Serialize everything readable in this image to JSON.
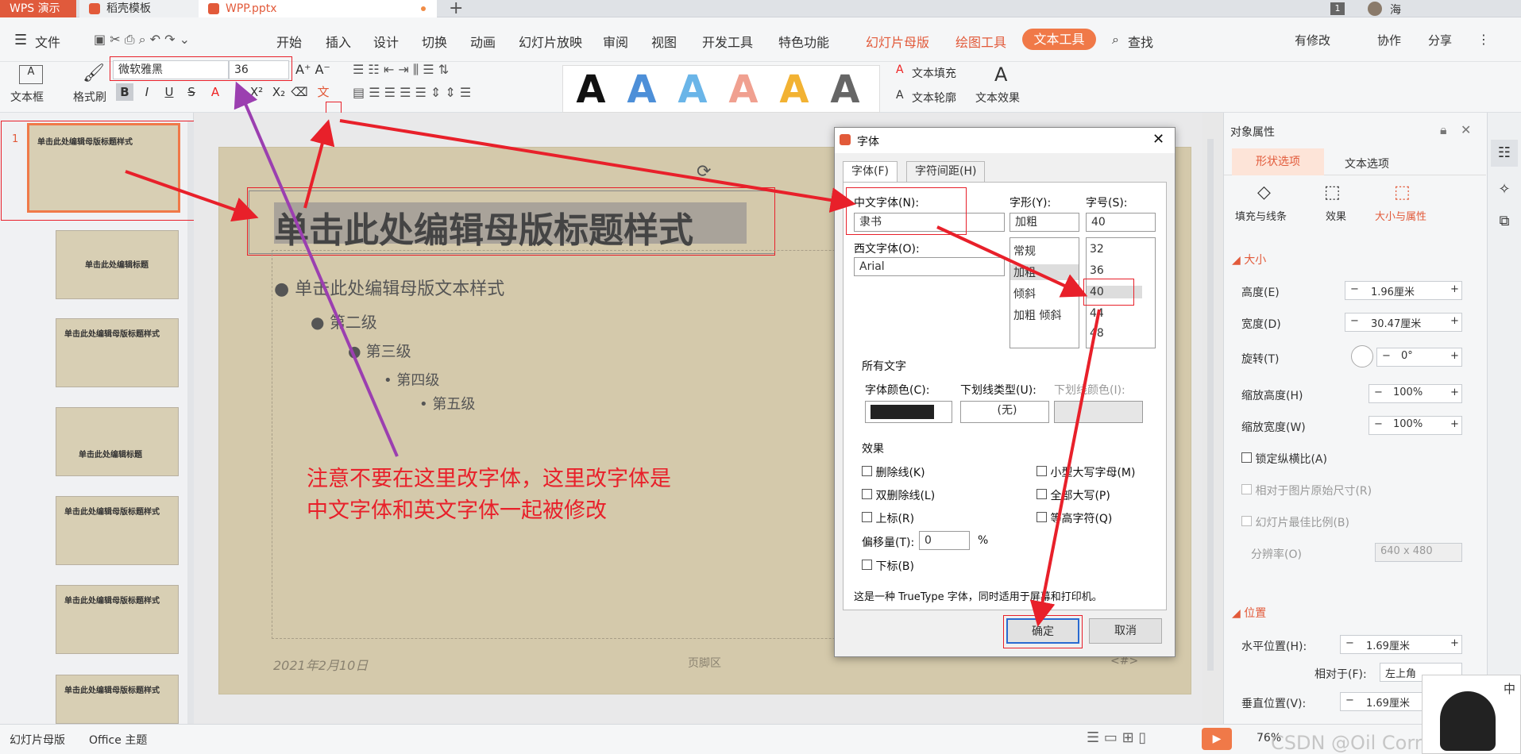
{
  "tabbar": {
    "brand": "WPS 演示",
    "tab1": "稻壳模板",
    "tab2": "WPP.pptx",
    "user_badge": "1",
    "user": "海"
  },
  "menu": {
    "file": "文件",
    "items": [
      "开始",
      "插入",
      "设计",
      "切换",
      "动画",
      "幻灯片放映",
      "审阅",
      "视图",
      "开发工具",
      "特色功能"
    ],
    "hl1": "幻灯片母版",
    "hl2": "绘图工具",
    "active": "文本工具",
    "search": "查找",
    "right": [
      "有修改",
      "协作",
      "分享"
    ]
  },
  "ribbon": {
    "textbox": "文本框",
    "format_brush": "格式刷",
    "font": "微软雅黑",
    "size": "36",
    "fill": "文本填充",
    "outline": "文本轮廓",
    "effect": "文本效果",
    "wordart": [
      "A",
      "A",
      "A",
      "A",
      "A",
      "A"
    ],
    "wordart_colors": [
      "#111111",
      "#4d8fd8",
      "#6ab5e8",
      "#f0a090",
      "#f2b233",
      "#666666"
    ]
  },
  "slide": {
    "title": "单击此处编辑母版标题样式",
    "l1": "单击此处编辑母版文本样式",
    "l2": "第二级",
    "l3": "第三级",
    "l4": "第四级",
    "l5": "第五级",
    "date": "2021年2月10日",
    "footer": "页脚区",
    "page": "<#>",
    "note1": "注意不要在这里改字体，这里改字体是",
    "note2": "中文字体和英文字体一起被修改"
  },
  "thumbs": {
    "first_num": "1",
    "t1": "单击此处编辑母版标题样式",
    "t2": "单击此处编辑标题",
    "t3": "单击此处编辑母版标题样式",
    "t4": "单击此处编辑标题",
    "t5": "单击此处编辑母版标题样式",
    "t6": "单击此处编辑母版标题样式",
    "t7": "单击此处编辑母版标题样式"
  },
  "dialog": {
    "title": "字体",
    "tab_font": "字体(F)",
    "tab_spacing": "字符间距(H)",
    "cn_font_label": "中文字体(N):",
    "cn_font": "隶书",
    "west_font_label": "西文字体(O):",
    "west_font": "Arial",
    "style_label": "字形(Y):",
    "style_val": "加粗",
    "styles": [
      "常规",
      "加粗",
      "倾斜",
      "加粗 倾斜"
    ],
    "size_label": "字号(S):",
    "size_val": "40",
    "sizes": [
      "32",
      "36",
      "40",
      "44",
      "48"
    ],
    "all_text": "所有文字",
    "color_label": "字体颜色(C):",
    "underline_label": "下划线类型(U):",
    "underline_val": "(无)",
    "ucolor_label": "下划线颜色(I):",
    "effects": "效果",
    "cb_left": [
      "删除线(K)",
      "双删除线(L)",
      "上标(R)"
    ],
    "cb_right": [
      "小型大写字母(M)",
      "全部大写(P)",
      "等高字符(Q)"
    ],
    "offset_label": "偏移量(T):",
    "offset_val": "0",
    "pct": "%",
    "subscript": "下标(B)",
    "desc": "这是一种 TrueType 字体，同时适用于屏幕和打印机。",
    "ok": "确定",
    "cancel": "取消"
  },
  "props": {
    "title": "对象属性",
    "tab1": "形状选项",
    "tab2": "文本选项",
    "sub1": "填充与线条",
    "sub2": "效果",
    "sub3": "大小与属性",
    "size_section": "大小",
    "height_label": "高度(E)",
    "height": "1.96厘米",
    "width_label": "宽度(D)",
    "width": "30.47厘米",
    "rot_label": "旋转(T)",
    "rot": "0°",
    "sh_label": "缩放高度(H)",
    "sh": "100%",
    "sw_label": "缩放宽度(W)",
    "sw": "100%",
    "lock": "锁定纵横比(A)",
    "orig": "相对于图片原始尺寸(R)",
    "best": "幻灯片最佳比例(B)",
    "res_label": "分辨率(O)",
    "res": "640 x 480",
    "pos_section": "位置",
    "hpos_label": "水平位置(H):",
    "hpos": "1.69厘米",
    "rel_label": "相对于(F):",
    "rel": "左上角",
    "vpos_label": "垂直位置(V):",
    "vpos": "1.69厘米"
  },
  "status": {
    "left": "幻灯片母版",
    "theme": "Office 主题",
    "zoom": "76%",
    "watermark": "CSDN @Oil Correct",
    "ime": "中"
  }
}
